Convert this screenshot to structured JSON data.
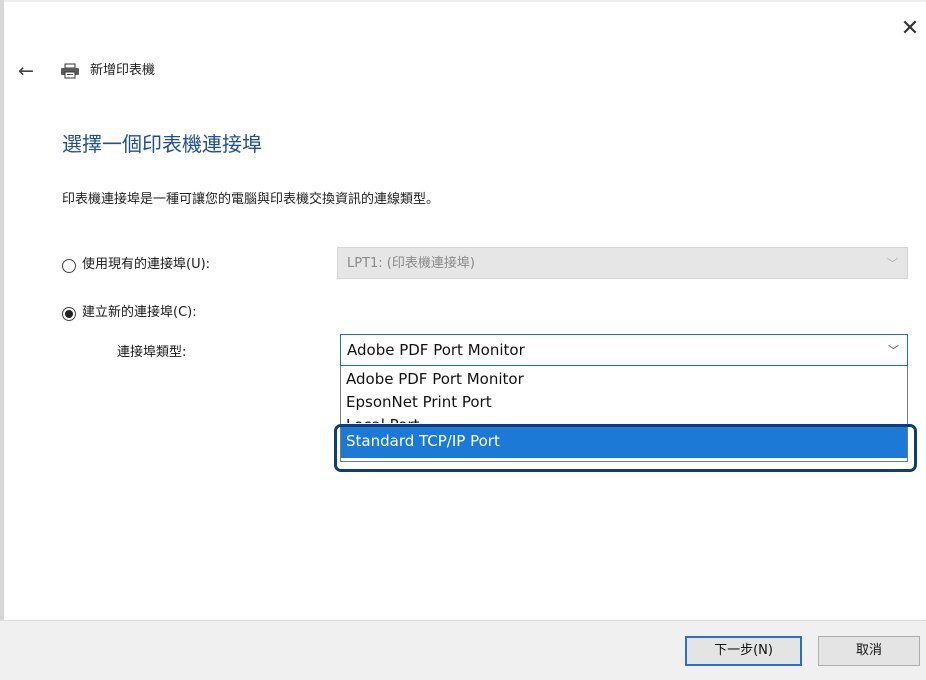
{
  "window": {
    "title": "新增印表機",
    "close_icon": "close-icon",
    "back_icon": "back-arrow-icon",
    "printer_icon": "printer-icon"
  },
  "page": {
    "heading": "選擇一個印表機連接埠",
    "description": "印表機連接埠是一種可讓您的電腦與印表機交換資訊的連線類型。"
  },
  "options": {
    "use_existing": {
      "label": "使用現有的連接埠(U):",
      "checked": false
    },
    "create_new": {
      "label": "建立新的連接埠(C):",
      "checked": true
    }
  },
  "existing_port": {
    "value": "LPT1: (印表機連接埠)",
    "disabled": true
  },
  "port_type": {
    "label": "連接埠類型:",
    "selected": "Adobe PDF Port Monitor",
    "options": [
      "Adobe PDF Port Monitor",
      "EpsonNet Print Port",
      "Local Port",
      "Standard TCP/IP Port"
    ],
    "highlighted": "Standard TCP/IP Port"
  },
  "buttons": {
    "next": "下一步(N)",
    "cancel": "取消"
  },
  "colors": {
    "heading": "#1f4e9a",
    "highlight": "#1c7ad6",
    "callout_border": "#0a3f78",
    "focus_border": "#1c6fc4"
  }
}
